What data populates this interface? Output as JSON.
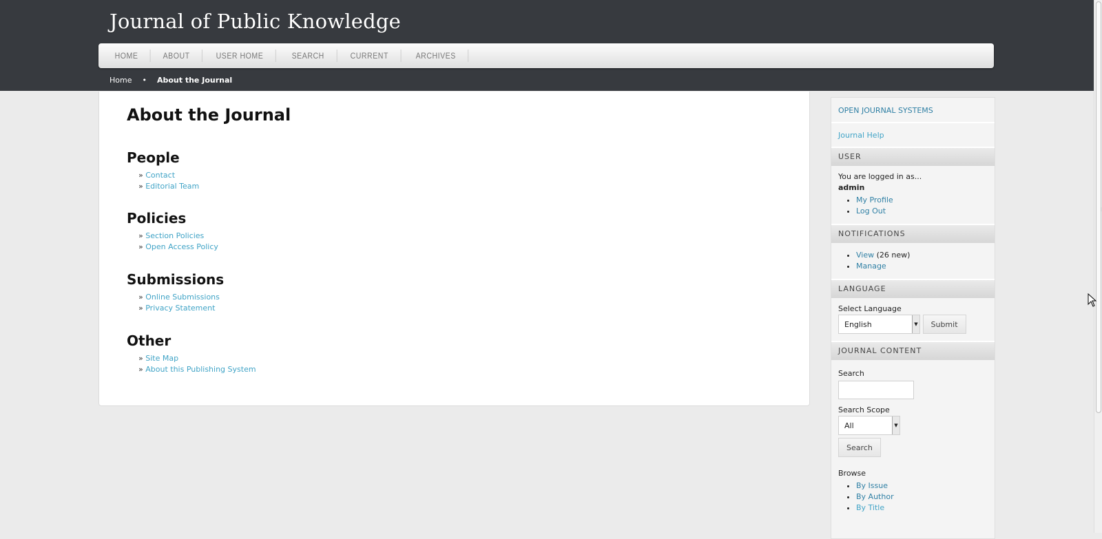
{
  "site": {
    "title": "Journal of Public Knowledge"
  },
  "nav": [
    "HOME",
    "ABOUT",
    "USER HOME",
    "SEARCH",
    "CURRENT",
    "ARCHIVES"
  ],
  "breadcrumb": {
    "home": "Home",
    "separator": "•",
    "current": "About the Journal"
  },
  "main": {
    "heading": "About the Journal",
    "sections": [
      {
        "title": "People",
        "links": [
          "Contact",
          "Editorial Team"
        ]
      },
      {
        "title": "Policies",
        "links": [
          "Section Policies",
          "Open Access Policy"
        ]
      },
      {
        "title": "Submissions",
        "links": [
          "Online Submissions",
          "Privacy Statement"
        ]
      },
      {
        "title": "Other",
        "links": [
          "Site Map",
          "About this Publishing System"
        ]
      }
    ],
    "bullet": "»"
  },
  "sidebar": {
    "ojs_link": "OPEN JOURNAL SYSTEMS",
    "help_link": "Journal Help",
    "user": {
      "title": "USER",
      "logged_in_text": "You are logged in as...",
      "username": "admin",
      "links": [
        "My Profile",
        "Log Out"
      ]
    },
    "notifications": {
      "title": "NOTIFICATIONS",
      "view_label": "View",
      "view_count": "(26 new)",
      "manage_label": "Manage"
    },
    "language": {
      "title": "LANGUAGE",
      "label": "Select Language",
      "selected": "English",
      "submit_label": "Submit"
    },
    "journal_content": {
      "title": "JOURNAL CONTENT",
      "search_label": "Search",
      "scope_label": "Search Scope",
      "scope_selected": "All",
      "search_button": "Search",
      "browse_label": "Browse",
      "browse_links": [
        "By Issue",
        "By Author",
        "By Title"
      ]
    }
  },
  "colors": {
    "header_bg": "#373a3f",
    "link": "#3fa3c6",
    "sidebar_link": "#2e7fa4",
    "page_bg": "#ebebeb"
  },
  "icons": {
    "dropdown": "triangle-down",
    "cursor": "mouse-pointer"
  }
}
